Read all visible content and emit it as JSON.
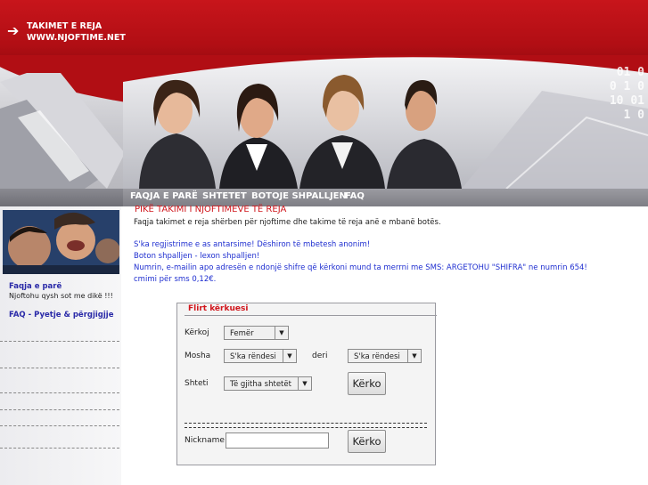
{
  "header": {
    "arrow_icon": "right-arrow-icon",
    "site_title": "TAKIMET E REJA",
    "site_url": "WWW.NJOFTIME.NET",
    "accent_color": "#c8151b"
  },
  "banner": {
    "binary_text": "01 0\n0 1 0\n10 01\n1 0",
    "image": "four-people-illustration"
  },
  "nav": {
    "items": [
      {
        "label": "FAQJA E PARË"
      },
      {
        "label": "SHTETET"
      },
      {
        "label": "BOTOJE SHPALLJEN"
      },
      {
        "label": "FAQ"
      }
    ]
  },
  "sidebar": {
    "photo": "crowd-photo",
    "link_home": "Faqja e parë",
    "tagline": "Njoftohu qysh sot me dikë !!!",
    "link_faq": "FAQ - Pyetje & përgjigjje"
  },
  "content": {
    "title": "PIKË TAKIMI I NJOFTIMEVE TË REJA",
    "intro": "Faqja takimet e reja shërben për njoftime dhe takime të reja anë e mbanë botës.",
    "line1": "S'ka regjistrime e as antarsime! Dëshiron të mbetesh anonim!",
    "line2": "Boton shpalljen - lexon shpalljen!",
    "line3": "Numrin, e-mailin apo adresën e ndonjë shifre që kërkoni mund ta merrni me SMS: ARGETOHU \"SHIFRA\" ne numrin 654!",
    "line4": "cmimi për sms 0,12€."
  },
  "search_panel": {
    "title": "Flirt kërkuesi",
    "label_seek": "Kërkoj",
    "seek_value": "Femër",
    "label_age": "Mosha",
    "age_from": "S'ka rëndesi",
    "label_to": "deri",
    "age_to": "S'ka rëndesi",
    "label_country": "Shteti",
    "country_value": "Të gjitha shtetët",
    "search_button": "Kërko",
    "label_nickname": "Nickname",
    "nickname_value": "",
    "nickname_button": "Kërko"
  }
}
